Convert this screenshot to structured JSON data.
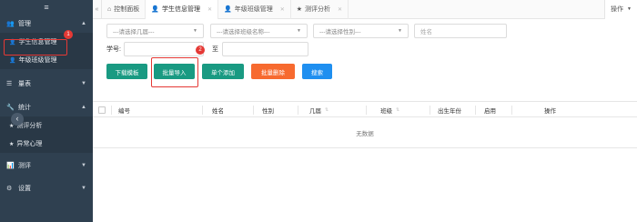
{
  "sidebar": {
    "menu_toggle": "≡",
    "collapse_glyph": "‹",
    "groups": [
      {
        "label": "管理",
        "icon": "users-icon"
      },
      {
        "label": "量表",
        "icon": "list-icon"
      },
      {
        "label": "统计",
        "icon": "wrench-icon"
      },
      {
        "label": "测评",
        "icon": "chart-icon"
      },
      {
        "label": "设置",
        "icon": "gear-icon"
      }
    ],
    "manage_items": [
      {
        "label": "学生信息管理"
      },
      {
        "label": "年级班级管理"
      }
    ],
    "stats_items": [
      {
        "label": "测评分析"
      },
      {
        "label": "异常心理"
      }
    ]
  },
  "badges": {
    "first": "1",
    "second": "2"
  },
  "tabs": {
    "items": [
      {
        "label": "控制面板",
        "icon": "home-icon"
      },
      {
        "label": "学生信息管理",
        "icon": "user-icon"
      },
      {
        "label": "年级班级管理",
        "icon": "user-icon"
      },
      {
        "label": "测评分析",
        "icon": "star-icon"
      }
    ],
    "right_label": "操作"
  },
  "filters": {
    "grade_placeholder": "---请选择几届---",
    "class_placeholder": "---请选择班级名称---",
    "gender_placeholder": "---请选择性别---",
    "name_placeholder": "姓名",
    "student_no_label": "学号:",
    "to_label": "至"
  },
  "buttons": {
    "download": "下载模板",
    "batch_import": "批量导入",
    "single_add": "单个添加",
    "batch_delete": "批量删除",
    "search": "搜索"
  },
  "colors": {
    "sidebar_bg": "#2f4050",
    "teal": "#199a82",
    "orange": "#f76a2f",
    "blue": "#1f8ff0",
    "highlight_red": "#e53935"
  },
  "table": {
    "columns": [
      "编号",
      "姓名",
      "性别",
      "几届",
      "班级",
      "出生年份",
      "启用",
      "操作"
    ],
    "empty_text": "无数据"
  }
}
